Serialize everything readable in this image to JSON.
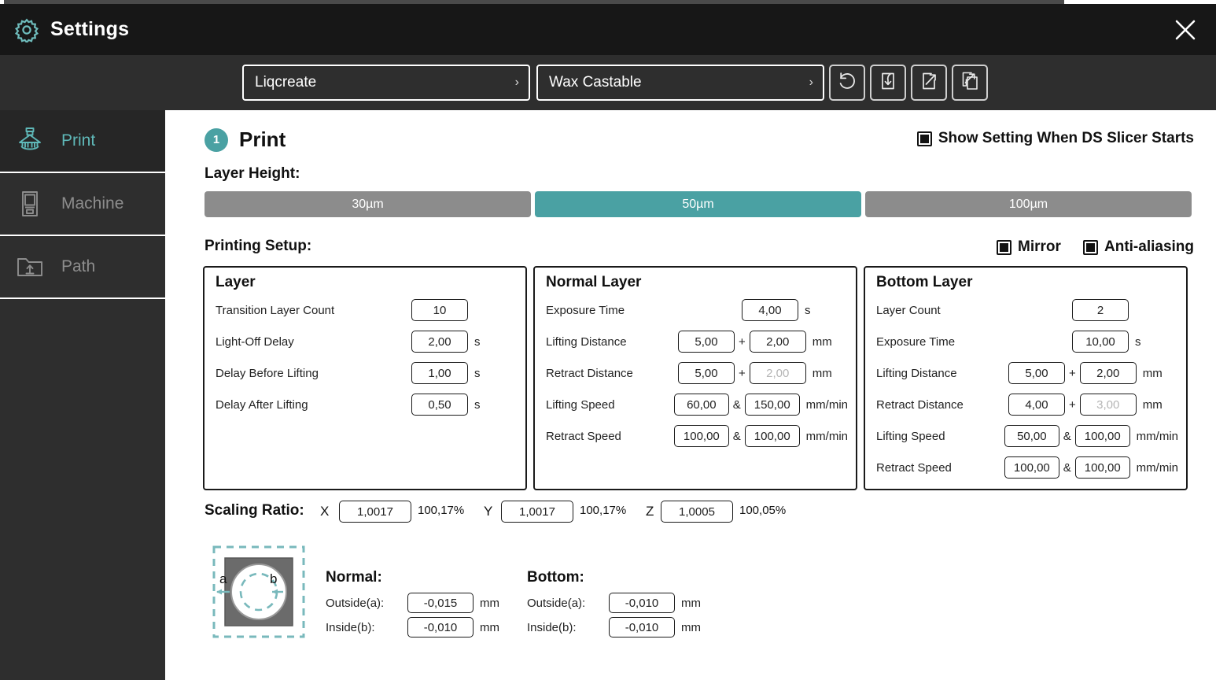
{
  "window": {
    "title": "Settings",
    "gear_icon": "gear-icon",
    "close_icon": "close-icon"
  },
  "toolbar": {
    "brand": {
      "value": "Liqcreate",
      "caret": "›"
    },
    "material": {
      "value": "Wax Castable",
      "caret": "›"
    },
    "buttons": [
      {
        "name": "reset-button",
        "icon": "reset-icon"
      },
      {
        "name": "import-button",
        "icon": "import-icon"
      },
      {
        "name": "export-button",
        "icon": "export-icon"
      },
      {
        "name": "export-all-button",
        "icon": "export-all-icon"
      }
    ]
  },
  "sidebar": {
    "items": [
      {
        "label": "Print",
        "icon": "printer-icon",
        "active": true
      },
      {
        "label": "Machine",
        "icon": "machine-icon",
        "active": false
      },
      {
        "label": "Path",
        "icon": "folder-upload-icon",
        "active": false
      }
    ]
  },
  "main": {
    "step_number": "1",
    "section_title": "Print",
    "show_setting": {
      "label": "Show Setting When DS Slicer Starts",
      "checked": true
    },
    "layer_height": {
      "label": "Layer Height:",
      "options": [
        "30µm",
        "50µm",
        "100µm"
      ],
      "selected_index": 1
    },
    "printing_setup": {
      "label": "Printing Setup:",
      "mirror": {
        "label": "Mirror",
        "checked": true
      },
      "anti_aliasing": {
        "label": "Anti-aliasing",
        "checked": true
      }
    },
    "panels": {
      "layer": {
        "title": "Layer",
        "rows": [
          {
            "label": "Transition Layer Count",
            "v1": "10",
            "unit": ""
          },
          {
            "label": "Light-Off Delay",
            "v1": "2,00",
            "unit": "s"
          },
          {
            "label": "Delay Before Lifting",
            "v1": "1,00",
            "unit": "s"
          },
          {
            "label": "Delay After Lifting",
            "v1": "0,50",
            "unit": "s"
          }
        ]
      },
      "normal": {
        "title": "Normal Layer",
        "rows": [
          {
            "label": "Exposure Time",
            "v1": "4,00",
            "unit": "s"
          },
          {
            "label": "Lifting Distance",
            "va": "5,00",
            "op": "+",
            "vb": "2,00",
            "unit": "mm",
            "vb_disabled": false
          },
          {
            "label": "Retract Distance",
            "va": "5,00",
            "op": "+",
            "vb": "2,00",
            "unit": "mm",
            "vb_disabled": true
          },
          {
            "label": "Lifting Speed",
            "va": "60,00",
            "op": "&",
            "vb": "150,00",
            "unit": "mm/min",
            "vb_disabled": false
          },
          {
            "label": "Retract Speed",
            "va": "100,00",
            "op": "&",
            "vb": "100,00",
            "unit": "mm/min",
            "vb_disabled": false
          }
        ]
      },
      "bottom": {
        "title": "Bottom Layer",
        "rows": [
          {
            "label": "Layer Count",
            "v1": "2",
            "unit": ""
          },
          {
            "label": "Exposure Time",
            "v1": "10,00",
            "unit": "s"
          },
          {
            "label": "Lifting Distance",
            "va": "5,00",
            "op": "+",
            "vb": "2,00",
            "unit": "mm",
            "vb_disabled": false
          },
          {
            "label": "Retract Distance",
            "va": "4,00",
            "op": "+",
            "vb": "3,00",
            "unit": "mm",
            "vb_disabled": true
          },
          {
            "label": "Lifting Speed",
            "va": "50,00",
            "op": "&",
            "vb": "100,00",
            "unit": "mm/min",
            "vb_disabled": false
          },
          {
            "label": "Retract Speed",
            "va": "100,00",
            "op": "&",
            "vb": "100,00",
            "unit": "mm/min",
            "vb_disabled": false
          }
        ]
      }
    },
    "scaling_ratio": {
      "label": "Scaling Ratio:",
      "x": {
        "axis": "X",
        "value": "1,0017",
        "percent": "100,17%"
      },
      "y": {
        "axis": "Y",
        "value": "1,0017",
        "percent": "100,17%"
      },
      "z": {
        "axis": "Z",
        "value": "1,0005",
        "percent": "100,05%"
      }
    },
    "compensation": {
      "diagram": {
        "label_a": "a",
        "label_b": "b",
        "icon": "compensation-diagram-icon"
      },
      "normal": {
        "title": "Normal:",
        "outside": {
          "label": "Outside(a):",
          "value": "-0,015",
          "unit": "mm"
        },
        "inside": {
          "label": "Inside(b):",
          "value": "-0,010",
          "unit": "mm"
        }
      },
      "bottom": {
        "title": "Bottom:",
        "outside": {
          "label": "Outside(a):",
          "value": "-0,010",
          "unit": "mm"
        },
        "inside": {
          "label": "Inside(b):",
          "value": "-0,010",
          "unit": "mm"
        }
      }
    }
  },
  "colors": {
    "accent_teal": "#4aa1a3",
    "sidebar_bg": "#2e2e2e",
    "titlebar_bg": "#171717",
    "inactive_gray": "#8c8c8c"
  }
}
